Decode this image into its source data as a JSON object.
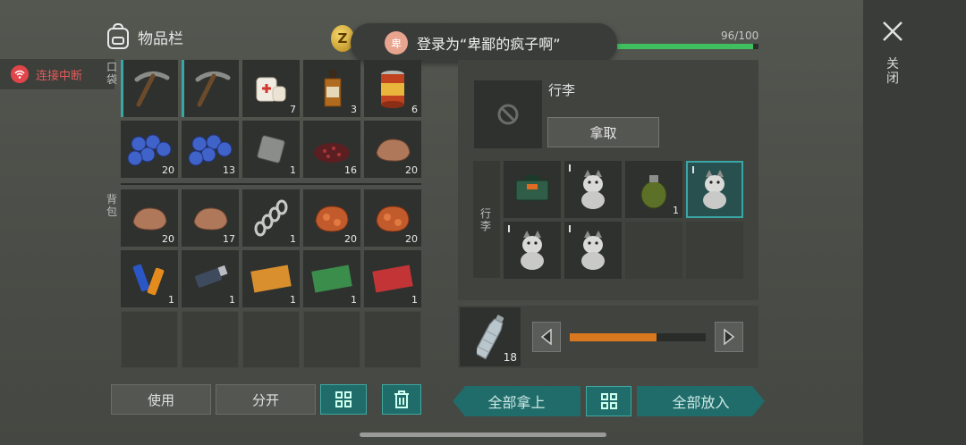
{
  "inventory": {
    "title": "物品栏",
    "pocket_label": "口袋",
    "backpack_label": "背包",
    "pocket_items": [
      {
        "icon": "pickaxe-icon",
        "count": ""
      },
      {
        "icon": "pickaxe-icon",
        "count": ""
      },
      {
        "icon": "bandage-icon",
        "count": "7"
      },
      {
        "icon": "whiskey-bottle-icon",
        "count": "3"
      },
      {
        "icon": "canned-food-icon",
        "count": "6"
      },
      {
        "icon": "blueberries-icon",
        "count": "20"
      },
      {
        "icon": "blueberries-icon",
        "count": "13"
      },
      {
        "icon": "metal-plate-icon",
        "count": "1"
      },
      {
        "icon": "gunpowder-icon",
        "count": "16"
      },
      {
        "icon": "stone-icon",
        "count": "20"
      }
    ],
    "backpack_items": [
      {
        "icon": "stone-icon",
        "count": "20"
      },
      {
        "icon": "stone-icon",
        "count": "17"
      },
      {
        "icon": "spring-icon",
        "count": "1"
      },
      {
        "icon": "copper-ore-icon",
        "count": "20"
      },
      {
        "icon": "copper-ore-icon",
        "count": "20"
      },
      {
        "icon": "batteries-icon",
        "count": "1"
      },
      {
        "icon": "usb-drive-icon",
        "count": "1"
      },
      {
        "icon": "coupon-orange-icon",
        "count": "1"
      },
      {
        "icon": "coupon-green-icon",
        "count": "1"
      },
      {
        "icon": "coupon-red-icon",
        "count": "1"
      },
      {
        "icon": "",
        "count": ""
      },
      {
        "icon": "",
        "count": ""
      },
      {
        "icon": "",
        "count": ""
      },
      {
        "icon": "",
        "count": ""
      },
      {
        "icon": "",
        "count": ""
      }
    ],
    "use_label": "使用",
    "split_label": "分开"
  },
  "connection": {
    "status": "连接中断"
  },
  "toast": {
    "avatar": "卑",
    "text": "登录为“卑鄙的疯子啊”"
  },
  "health": {
    "text": "96/100",
    "fraction": 0.96
  },
  "bag": {
    "title": "行李",
    "take_label": "拿取",
    "side_label": "行李",
    "items": [
      {
        "icon": "military-crate-icon",
        "count": "",
        "tick": false
      },
      {
        "icon": "husky-dog-icon",
        "count": "",
        "tick": true
      },
      {
        "icon": "grenade-icon",
        "count": "1",
        "tick": false
      },
      {
        "icon": "husky-dog-icon",
        "count": "",
        "tick": true,
        "highlight": true
      },
      {
        "icon": "husky-dog-icon",
        "count": "",
        "tick": true
      },
      {
        "icon": "husky-dog-icon",
        "count": "",
        "tick": true
      },
      {
        "icon": "",
        "count": "",
        "tick": false
      },
      {
        "icon": "",
        "count": "",
        "tick": false
      }
    ]
  },
  "transfer": {
    "item_icon": "water-bottle-icon",
    "count": "18",
    "slider_fraction": 0.64
  },
  "actions": {
    "take_all": "全部拿上",
    "put_all": "全部放入"
  },
  "close": {
    "label": "关闭"
  }
}
